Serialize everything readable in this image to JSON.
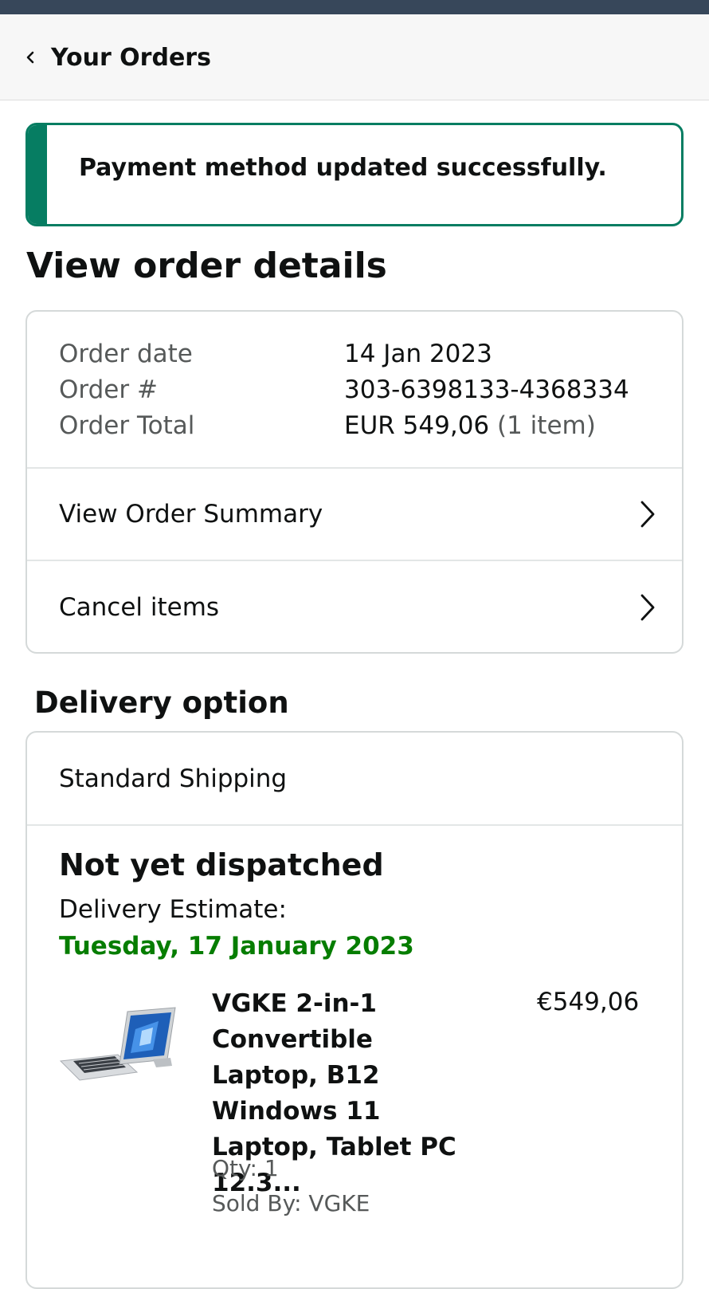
{
  "header": {
    "back_label": "Your Orders"
  },
  "alert": {
    "message": "Payment method updated successfully."
  },
  "page_title": "View order details",
  "order": {
    "date_label": "Order date",
    "date_value": "14 Jan 2023",
    "number_label": "Order #",
    "number_value": "303-6398133-4368334",
    "total_label": "Order Total",
    "total_value": "EUR 549,06",
    "total_items": "(1 item)"
  },
  "links": {
    "view_summary": "View Order Summary",
    "cancel_items": "Cancel items"
  },
  "delivery": {
    "section_title": "Delivery option",
    "shipping_method": "Standard Shipping",
    "status": "Not yet dispatched",
    "estimate_label": "Delivery Estimate:",
    "estimate_date": "Tuesday, 17 January 2023"
  },
  "product": {
    "title": "VGKE 2-in-1 Convertible Laptop, B12 Windows 11 Laptop, Tablet PC 12.3...",
    "price": "€549,06",
    "qty": "Qty: 1",
    "seller": "Sold By: VGKE"
  },
  "colors": {
    "success_green": "#067d62",
    "date_green": "#067d00",
    "muted_text": "#565959",
    "border": "#d5d9d9"
  },
  "icons": {
    "back": "chevron-left-icon",
    "row_arrow": "chevron-right-icon",
    "product_image": "laptop-tablet-image"
  }
}
